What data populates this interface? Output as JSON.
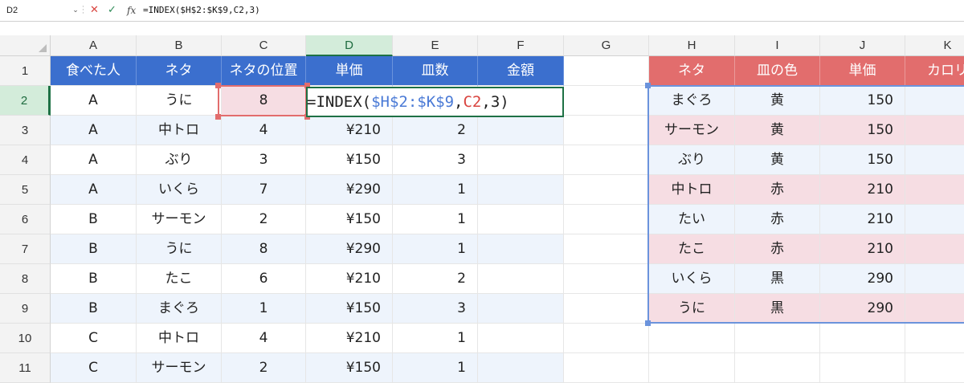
{
  "formula_bar": {
    "name_box": "D2",
    "formula": "=INDEX($H$2:$K$9,C2,3)",
    "fx_label": "fx"
  },
  "columns": [
    "A",
    "B",
    "C",
    "D",
    "E",
    "F",
    "G",
    "H",
    "I",
    "J",
    "K"
  ],
  "rows": [
    "1",
    "2",
    "3",
    "4",
    "5",
    "6",
    "7",
    "8",
    "9",
    "10",
    "11"
  ],
  "selected_cell": "D2",
  "left_table": {
    "headers": [
      "食べた人",
      "ネタ",
      "ネタの位置",
      "単価",
      "皿数",
      "金額"
    ],
    "rows": [
      {
        "person": "A",
        "neta": "うに",
        "pos": "8",
        "price": "",
        "count": "",
        "amount": ""
      },
      {
        "person": "A",
        "neta": "中トロ",
        "pos": "4",
        "price": "¥210",
        "count": "2",
        "amount": ""
      },
      {
        "person": "A",
        "neta": "ぶり",
        "pos": "3",
        "price": "¥150",
        "count": "3",
        "amount": ""
      },
      {
        "person": "A",
        "neta": "いくら",
        "pos": "7",
        "price": "¥290",
        "count": "1",
        "amount": ""
      },
      {
        "person": "B",
        "neta": "サーモン",
        "pos": "2",
        "price": "¥150",
        "count": "1",
        "amount": ""
      },
      {
        "person": "B",
        "neta": "うに",
        "pos": "8",
        "price": "¥290",
        "count": "1",
        "amount": ""
      },
      {
        "person": "B",
        "neta": "たこ",
        "pos": "6",
        "price": "¥210",
        "count": "2",
        "amount": ""
      },
      {
        "person": "B",
        "neta": "まぐろ",
        "pos": "1",
        "price": "¥150",
        "count": "3",
        "amount": ""
      },
      {
        "person": "C",
        "neta": "中トロ",
        "pos": "4",
        "price": "¥210",
        "count": "1",
        "amount": ""
      },
      {
        "person": "C",
        "neta": "サーモン",
        "pos": "2",
        "price": "¥150",
        "count": "1",
        "amount": ""
      }
    ]
  },
  "right_table": {
    "headers": [
      "ネタ",
      "皿の色",
      "単価",
      "カロリ"
    ],
    "rows": [
      {
        "neta": "まぐろ",
        "color": "黄",
        "price": "150"
      },
      {
        "neta": "サーモン",
        "color": "黄",
        "price": "150"
      },
      {
        "neta": "ぶり",
        "color": "黄",
        "price": "150"
      },
      {
        "neta": "中トロ",
        "color": "赤",
        "price": "210"
      },
      {
        "neta": "たい",
        "color": "赤",
        "price": "210"
      },
      {
        "neta": "たこ",
        "color": "赤",
        "price": "210"
      },
      {
        "neta": "いくら",
        "color": "黒",
        "price": "290"
      },
      {
        "neta": "うに",
        "color": "黒",
        "price": "290"
      }
    ]
  },
  "formula_tokens": {
    "prefix": "=INDEX(",
    "range": "$H$2:$K$9",
    "sep1": ",",
    "ref": "C2",
    "suffix": ",3)"
  },
  "colors": {
    "left_header": "#3b6fce",
    "right_header": "#e26d6d",
    "selection": "#1e7145"
  }
}
